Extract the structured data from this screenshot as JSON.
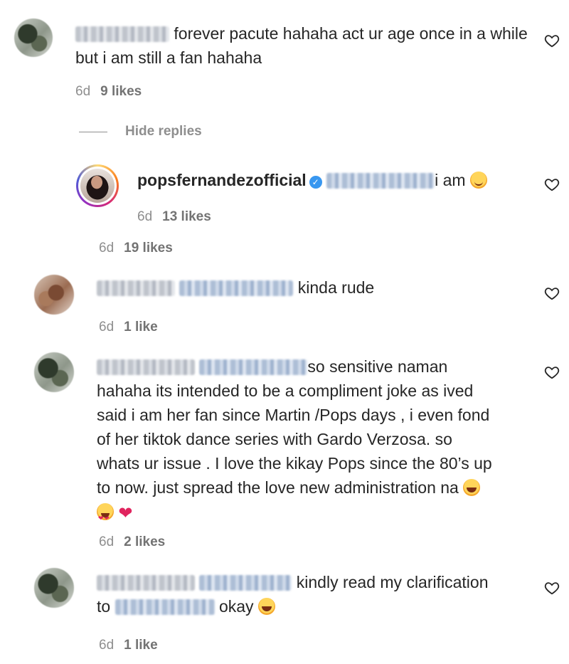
{
  "comments": [
    {
      "text_line1": "forever pacute hahaha act ur age once in a while",
      "text_line2": "but i am still a fan hahaha",
      "time": "6d",
      "likes": "9 likes"
    },
    {
      "reply": {
        "username": "popsfernandezofficial",
        "text": "i am",
        "time": "6d",
        "likes": "13 likes"
      },
      "time": "6d",
      "likes": "19 likes"
    },
    {
      "text": "kinda rude",
      "time": "6d",
      "likes": "1 like"
    },
    {
      "text_line1": "so sensitive naman",
      "text_line2": "hahaha its intended to be a compliment joke as ived",
      "text_line3": "said i am her fan since Martin /Pops days , i even fond",
      "text_line4": "of her tiktok dance series with Gardo Verzosa. so",
      "text_line5": "whats ur issue . I love the kikay Pops since the 80’s up",
      "text_line6": "to now. just spread the love new administration na",
      "time": "6d",
      "likes": "2 likes"
    },
    {
      "text_line1": "kindly read my clarification",
      "text_line2_prefix": "to",
      "text_line2_suffix": "okay",
      "time": "6d",
      "likes": "1 like"
    }
  ],
  "hide_replies_label": "Hide replies",
  "icons": {
    "heart": "heart-outline-icon",
    "verified": "verified-badge-icon"
  },
  "colors": {
    "text": "#262626",
    "meta": "#8e8e8e",
    "verified": "#3897f0"
  }
}
